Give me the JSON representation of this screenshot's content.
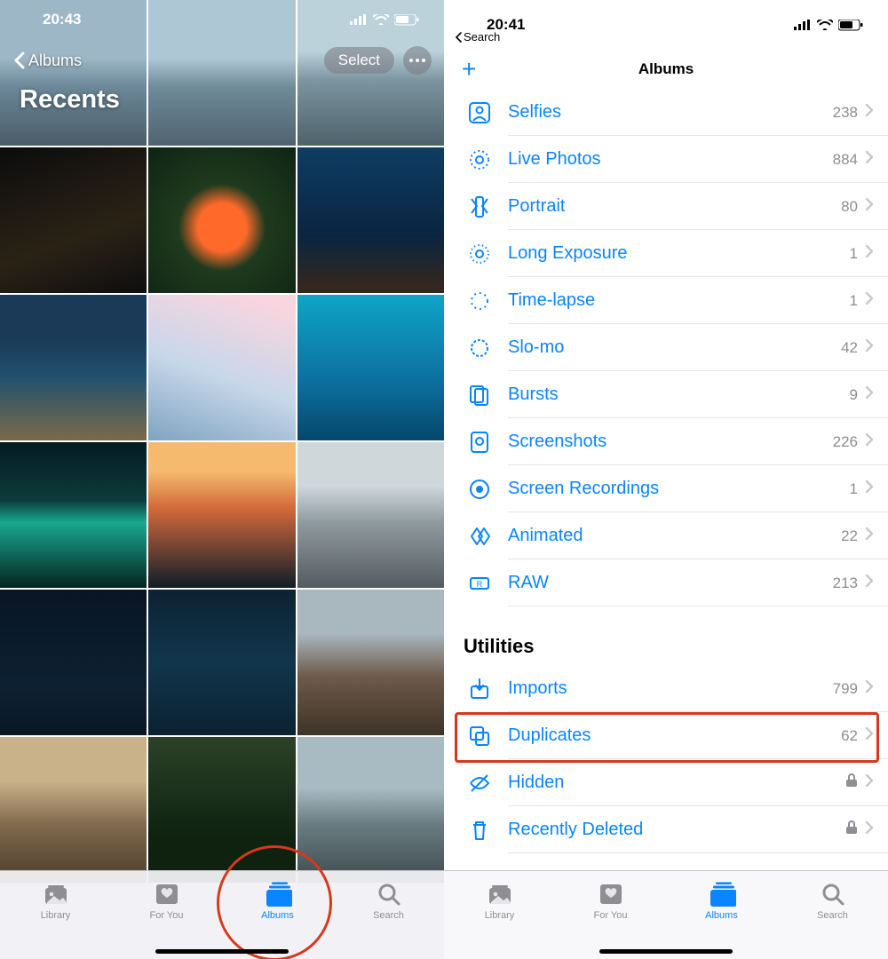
{
  "left": {
    "statusTime": "20:43",
    "backLabel": "Albums",
    "albumTitle": "Recents",
    "selectLabel": "Select",
    "tabs": {
      "library": "Library",
      "foryou": "For You",
      "albums": "Albums",
      "search": "Search"
    }
  },
  "right": {
    "statusTime": "20:41",
    "backSearch": "Search",
    "title": "Albums",
    "mediaTypes": [
      {
        "icon": "person",
        "label": "Selfies",
        "count": "238"
      },
      {
        "icon": "live",
        "label": "Live Photos",
        "count": "884"
      },
      {
        "icon": "portrait",
        "label": "Portrait",
        "count": "80"
      },
      {
        "icon": "longexp",
        "label": "Long Exposure",
        "count": "1"
      },
      {
        "icon": "timelapse",
        "label": "Time-lapse",
        "count": "1"
      },
      {
        "icon": "slomo",
        "label": "Slo-mo",
        "count": "42"
      },
      {
        "icon": "bursts",
        "label": "Bursts",
        "count": "9"
      },
      {
        "icon": "screenshots",
        "label": "Screenshots",
        "count": "226"
      },
      {
        "icon": "screenrec",
        "label": "Screen Recordings",
        "count": "1"
      },
      {
        "icon": "animated",
        "label": "Animated",
        "count": "22"
      },
      {
        "icon": "raw",
        "label": "RAW",
        "count": "213"
      }
    ],
    "utilitiesHeader": "Utilities",
    "utilities": [
      {
        "icon": "imports",
        "label": "Imports",
        "count": "799"
      },
      {
        "icon": "duplicates",
        "label": "Duplicates",
        "count": "62"
      },
      {
        "icon": "hidden",
        "label": "Hidden",
        "lock": true
      },
      {
        "icon": "deleted",
        "label": "Recently Deleted",
        "lock": true
      }
    ],
    "tabs": {
      "library": "Library",
      "foryou": "For You",
      "albums": "Albums",
      "search": "Search"
    }
  }
}
